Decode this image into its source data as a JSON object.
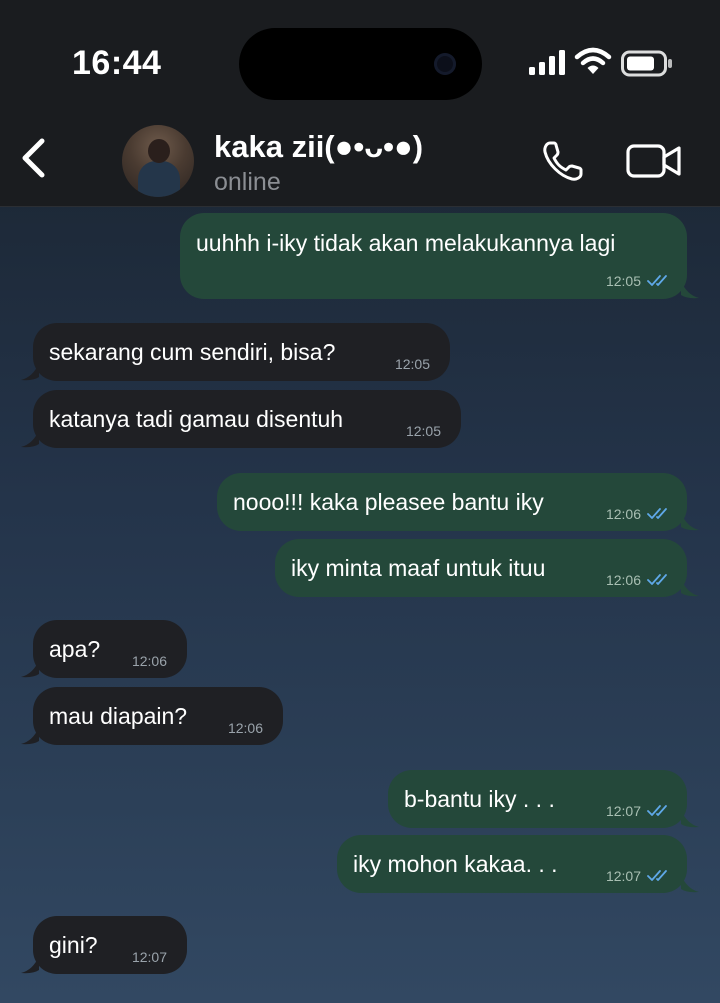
{
  "status_bar": {
    "time": "16:44"
  },
  "chat_header": {
    "contact_name": "kaka zii(●•ᴗ•●)",
    "contact_status": "online"
  },
  "colors": {
    "outgoing_bubble": "#24483a",
    "incoming_bubble": "#1f2024",
    "read_ticks": "#5fa8e8"
  },
  "messages": [
    {
      "direction": "outgoing",
      "text": "uuhhh i-iky tidak akan melakukannya lagi",
      "time": "12:05",
      "read": true
    },
    {
      "direction": "incoming",
      "text": "sekarang cum sendiri, bisa?",
      "time": "12:05"
    },
    {
      "direction": "incoming",
      "text": "katanya tadi gamau disentuh",
      "time": "12:05"
    },
    {
      "direction": "outgoing",
      "text": "nooo!!! kaka pleasee bantu iky",
      "time": "12:06",
      "read": true
    },
    {
      "direction": "outgoing",
      "text": "iky minta maaf untuk ituu",
      "time": "12:06",
      "read": true
    },
    {
      "direction": "incoming",
      "text": "apa?",
      "time": "12:06"
    },
    {
      "direction": "incoming",
      "text": "mau diapain?",
      "time": "12:06"
    },
    {
      "direction": "outgoing",
      "text": "b-bantu iky . . .",
      "time": "12:07",
      "read": true
    },
    {
      "direction": "outgoing",
      "text": "iky mohon kakaa. . .",
      "time": "12:07",
      "read": true
    },
    {
      "direction": "incoming",
      "text": "gini?",
      "time": "12:07"
    }
  ]
}
